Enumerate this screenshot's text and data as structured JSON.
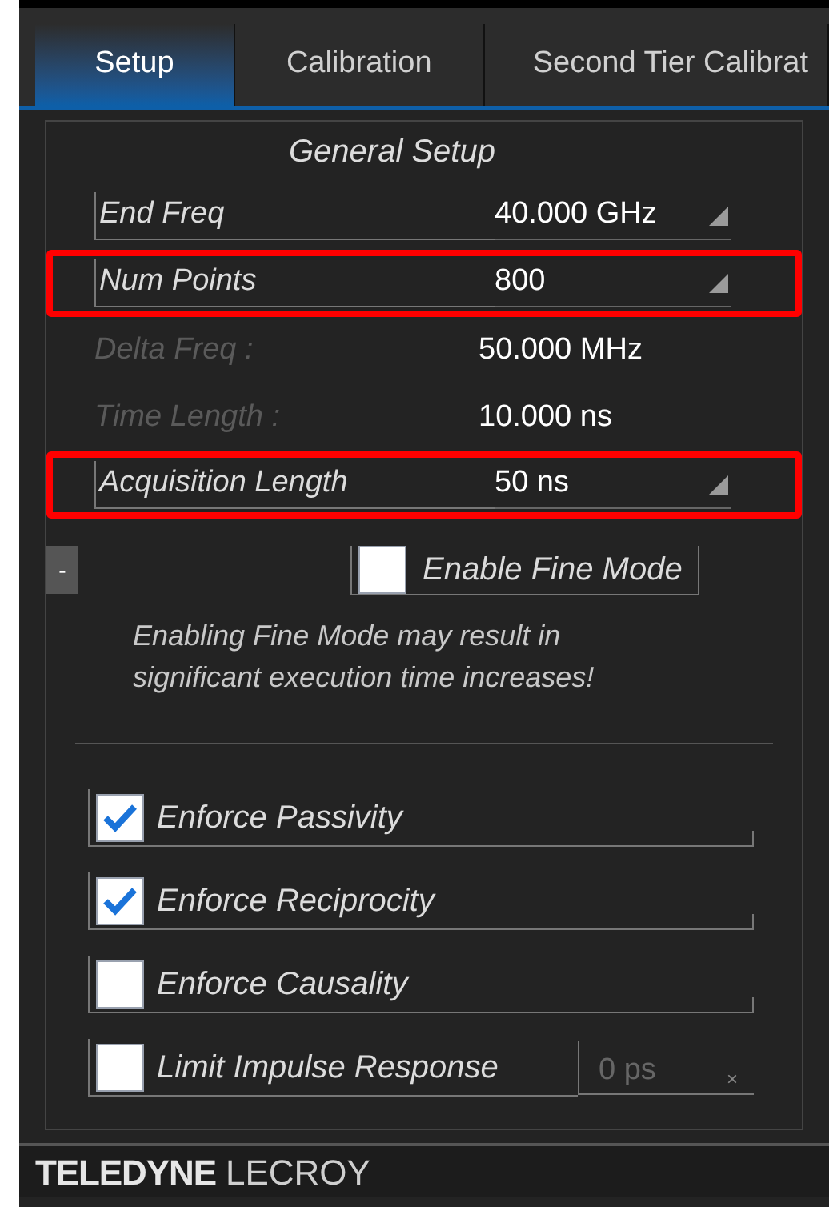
{
  "tabs": [
    {
      "label": "Setup",
      "selected": true
    },
    {
      "label": "Calibration",
      "selected": false
    },
    {
      "label": "Second Tier Calibrat",
      "selected": false
    }
  ],
  "panel": {
    "title": "General Setup",
    "fields": [
      {
        "kind": "dropdown",
        "label": "End Freq",
        "value": "40.000 GHz",
        "highlighted": false
      },
      {
        "kind": "dropdown",
        "label": "Num Points",
        "value": "800",
        "highlighted": true
      },
      {
        "kind": "readonly",
        "label": "Delta Freq :",
        "value": "50.000 MHz",
        "highlighted": false
      },
      {
        "kind": "readonly",
        "label": "Time Length :",
        "value": "10.000 ns",
        "highlighted": false
      },
      {
        "kind": "dropdown",
        "label": "Acquisition Length",
        "value": "50 ns",
        "highlighted": true
      }
    ],
    "collapse_button": "-",
    "fine_mode": {
      "label": "Enable Fine Mode",
      "checked": false
    },
    "warning": "Enabling Fine Mode may result in significant execution time increases!",
    "options": [
      {
        "label": "Enforce Passivity",
        "checked": true
      },
      {
        "label": "Enforce Reciprocity",
        "checked": true
      },
      {
        "label": "Enforce Causality",
        "checked": false
      },
      {
        "label": "Limit Impulse Response",
        "checked": false,
        "input_placeholder": "0 ps",
        "clear": "×"
      }
    ]
  },
  "footer": {
    "brand_bold": "TELEDYNE",
    "brand_light": "LECROY"
  }
}
